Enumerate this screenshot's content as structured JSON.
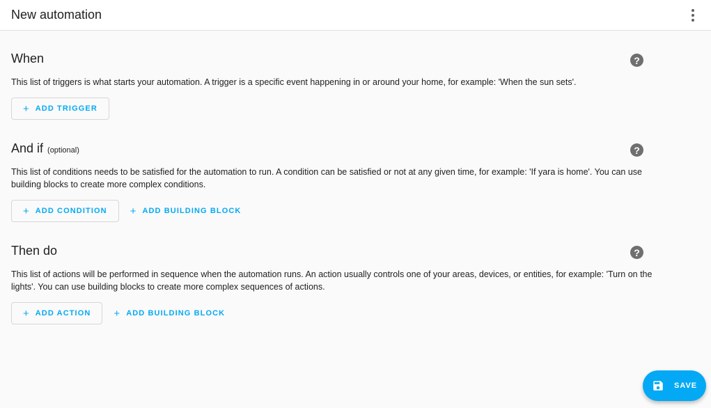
{
  "header": {
    "title": "New automation",
    "menu_icon": "dots-vertical-icon"
  },
  "sections": [
    {
      "title": "When",
      "subtitle": "",
      "help_icon": "help-circle-icon",
      "description": "This list of triggers is what starts your automation. A trigger is a specific event happening in or around your home, for example: 'When the sun sets'.",
      "primary_button": {
        "icon": "+",
        "label": "ADD TRIGGER"
      },
      "secondary_button": null
    },
    {
      "title": "And if",
      "subtitle": "(optional)",
      "help_icon": "help-circle-icon",
      "description": "This list of conditions needs to be satisfied for the automation to run. A condition can be satisfied or not at any given time, for example: 'If yara is home'. You can use building blocks to create more complex conditions.",
      "primary_button": {
        "icon": "+",
        "label": "ADD CONDITION"
      },
      "secondary_button": {
        "icon": "+",
        "label": "ADD BUILDING BLOCK"
      }
    },
    {
      "title": "Then do",
      "subtitle": "",
      "help_icon": "help-circle-icon",
      "description": "This list of actions will be performed in sequence when the automation runs. An action usually controls one of your areas, devices, or entities, for example: 'Turn on the lights'. You can use building blocks to create more complex sequences of actions.",
      "primary_button": {
        "icon": "+",
        "label": "ADD ACTION"
      },
      "secondary_button": {
        "icon": "+",
        "label": "ADD BUILDING BLOCK"
      }
    }
  ],
  "fab": {
    "icon": "content-save-icon",
    "label": "SAVE"
  },
  "help_glyph": "?",
  "colors": {
    "accent": "#03a9f4",
    "background": "#fafafa",
    "help_icon": "#6f6f6f"
  }
}
